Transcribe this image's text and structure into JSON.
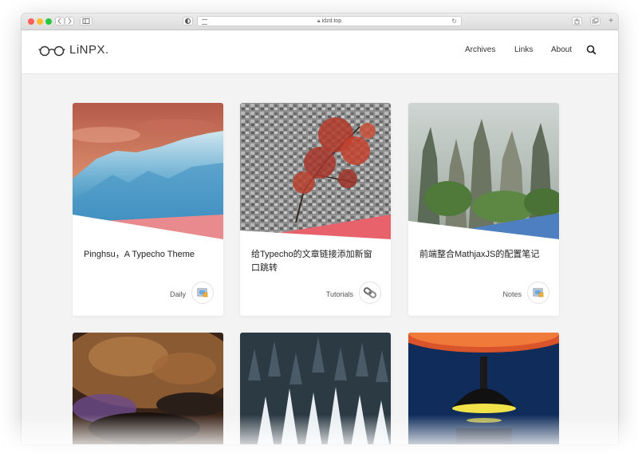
{
  "browser": {
    "url": "idzd.top",
    "traffic_lights": [
      "#fe5f57",
      "#febc2e",
      "#28c840"
    ]
  },
  "site": {
    "logo_text": "LiNPX.",
    "nav": [
      "Archives",
      "Links",
      "About"
    ]
  },
  "posts": [
    {
      "title": "Pinghsu，A Typecho Theme",
      "category": "Daily",
      "category_icon": "picture-icon"
    },
    {
      "title": "给Typecho的文章链接添加新窗口跳转",
      "category": "Tutorials",
      "category_icon": "link-icon"
    },
    {
      "title": "前端整合MathjaxJS的配置笔记",
      "category": "Notes",
      "category_icon": "picture-icon"
    }
  ],
  "colors": {
    "accent_coral": "#e8626b",
    "accent_blue": "#4d7fc1",
    "accent_pink": "#e98a8f"
  }
}
